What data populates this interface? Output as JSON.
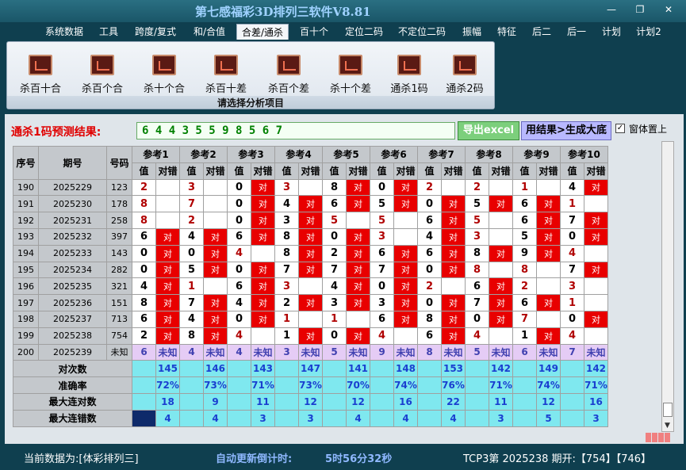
{
  "title": "第七感福彩3D排列三软件V8.81",
  "menu": [
    "系统数据",
    "工具",
    "跨度/复式",
    "和/合值",
    "合差/通杀",
    "百十个",
    "定位二码",
    "不定位二码",
    "振幅",
    "特征",
    "后二",
    "后一",
    "计划",
    "计划2"
  ],
  "ribbon": {
    "buttons": [
      "杀百十合",
      "杀百个合",
      "杀十个合",
      "杀百十差",
      "杀百个差",
      "杀十个差",
      "通杀1码",
      "通杀2码"
    ],
    "caption": "请选择分析项目"
  },
  "prediction": {
    "label": "通杀1码预测结果:",
    "value": "6 4 4 3 5 5 9 8 5 6 7",
    "export": "导出excel",
    "generate": "用结果>生成大底",
    "ontop": "窗体置上"
  },
  "table": {
    "h_seq": "序号",
    "h_period": "期号",
    "h_num": "号码",
    "refs": [
      "参考1",
      "参考2",
      "参考3",
      "参考4",
      "参考5",
      "参考6",
      "参考7",
      "参考8",
      "参考9",
      "参考10"
    ],
    "sub_val": "值",
    "sub_res": "对错",
    "hit": "对",
    "unknown": "未知",
    "rows": [
      {
        "seq": "190",
        "period": "2025229",
        "num": "123",
        "vals": [
          "2",
          "3",
          "0",
          "3",
          "8",
          "0",
          "2",
          "2",
          "1",
          "4"
        ],
        "hits": [
          0,
          0,
          1,
          0,
          1,
          1,
          0,
          0,
          0,
          1
        ]
      },
      {
        "seq": "191",
        "period": "2025230",
        "num": "178",
        "vals": [
          "8",
          "7",
          "0",
          "4",
          "6",
          "5",
          "0",
          "5",
          "6",
          "1"
        ],
        "hits": [
          0,
          0,
          1,
          1,
          1,
          1,
          1,
          1,
          1,
          0
        ]
      },
      {
        "seq": "192",
        "period": "2025231",
        "num": "258",
        "vals": [
          "8",
          "2",
          "0",
          "3",
          "5",
          "5",
          "6",
          "5",
          "6",
          "7"
        ],
        "hits": [
          0,
          0,
          1,
          1,
          0,
          0,
          1,
          0,
          1,
          1
        ]
      },
      {
        "seq": "193",
        "period": "2025232",
        "num": "397",
        "vals": [
          "6",
          "4",
          "6",
          "8",
          "0",
          "3",
          "4",
          "3",
          "5",
          "0"
        ],
        "hits": [
          1,
          1,
          1,
          1,
          1,
          0,
          1,
          0,
          1,
          1
        ]
      },
      {
        "seq": "194",
        "period": "2025233",
        "num": "143",
        "vals": [
          "0",
          "0",
          "4",
          "8",
          "2",
          "6",
          "6",
          "8",
          "9",
          "4"
        ],
        "hits": [
          1,
          1,
          0,
          1,
          1,
          1,
          1,
          1,
          1,
          0
        ]
      },
      {
        "seq": "195",
        "period": "2025234",
        "num": "282",
        "vals": [
          "0",
          "5",
          "0",
          "7",
          "7",
          "7",
          "0",
          "8",
          "8",
          "7"
        ],
        "hits": [
          1,
          1,
          1,
          1,
          1,
          1,
          1,
          0,
          0,
          1
        ]
      },
      {
        "seq": "196",
        "period": "2025235",
        "num": "321",
        "vals": [
          "4",
          "1",
          "6",
          "3",
          "4",
          "0",
          "2",
          "6",
          "2",
          "3"
        ],
        "hits": [
          1,
          0,
          1,
          0,
          1,
          1,
          0,
          1,
          0,
          0
        ]
      },
      {
        "seq": "197",
        "period": "2025236",
        "num": "151",
        "vals": [
          "8",
          "7",
          "4",
          "2",
          "3",
          "3",
          "0",
          "7",
          "6",
          "1"
        ],
        "hits": [
          1,
          1,
          1,
          1,
          1,
          1,
          1,
          1,
          1,
          0
        ]
      },
      {
        "seq": "198",
        "period": "2025237",
        "num": "713",
        "vals": [
          "6",
          "4",
          "0",
          "1",
          "1",
          "6",
          "8",
          "0",
          "7",
          "0"
        ],
        "hits": [
          1,
          1,
          1,
          0,
          0,
          1,
          1,
          1,
          0,
          1
        ]
      },
      {
        "seq": "199",
        "period": "2025238",
        "num": "754",
        "vals": [
          "2",
          "8",
          "4",
          "1",
          "0",
          "4",
          "6",
          "4",
          "1",
          "4"
        ],
        "hits": [
          1,
          1,
          0,
          1,
          1,
          0,
          1,
          0,
          1,
          0
        ]
      },
      {
        "seq": "200",
        "period": "2025239",
        "num": "未知",
        "vals": [
          "6",
          "4",
          "4",
          "3",
          "5",
          "9",
          "8",
          "5",
          "6",
          "7"
        ],
        "hits": [
          2,
          2,
          2,
          2,
          2,
          2,
          2,
          2,
          2,
          2
        ]
      }
    ],
    "stats": [
      {
        "label": "对次数",
        "vals": [
          "145",
          "146",
          "143",
          "147",
          "141",
          "148",
          "153",
          "142",
          "149",
          "142"
        ]
      },
      {
        "label": "准确率",
        "vals": [
          "72%",
          "73%",
          "71%",
          "73%",
          "70%",
          "74%",
          "76%",
          "71%",
          "74%",
          "71%"
        ]
      },
      {
        "label": "最大连对数",
        "vals": [
          "18",
          "9",
          "11",
          "12",
          "12",
          "16",
          "22",
          "11",
          "12",
          "16"
        ]
      },
      {
        "label": "最大连错数",
        "vals": [
          "4",
          "4",
          "3",
          "3",
          "4",
          "4",
          "4",
          "3",
          "5",
          "3"
        ]
      }
    ]
  },
  "status": {
    "current": "当前数据为:[体彩排列三]",
    "countdown_label": "自动更新倒计时:",
    "countdown": "5时56分32秒",
    "tcp": "TCP3第 2025238 期开:【754】【746】"
  }
}
